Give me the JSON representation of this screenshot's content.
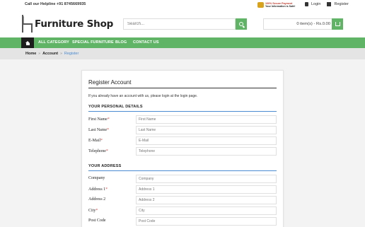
{
  "topbar": {
    "helpline": "Call our Helpline +91 8745669935",
    "secure_line1": "100% Secure Payment",
    "secure_line2": "Your Information is Safe!",
    "login": "Login",
    "register": "Register"
  },
  "header": {
    "logo": "Furniture Shop",
    "search_placeholder": "Search...",
    "cart": "0 item(s) - Rs.0.00"
  },
  "nav": {
    "items": [
      "ALL CATEGORY",
      "SPECIAL FURNITURE",
      "BLOG",
      "CONTACT US"
    ]
  },
  "breadcrumb": [
    "Home",
    "Account",
    "Register"
  ],
  "form": {
    "title": "Register Account",
    "intro": "If you already have an account with us, please login at the login page.",
    "personal_section": "YOUR PERSONAL DETAILS",
    "address_section": "YOUR ADDRESS",
    "fields": {
      "first_name": {
        "label": "First Name",
        "placeholder": "First Name"
      },
      "last_name": {
        "label": "Last Name",
        "placeholder": "Last Name"
      },
      "email": {
        "label": "E-Mail",
        "placeholder": "E-Mail"
      },
      "telephone": {
        "label": "Telephone",
        "placeholder": "Telephone"
      },
      "company": {
        "label": "Company",
        "placeholder": "Company"
      },
      "address1": {
        "label": "Address 1",
        "placeholder": "Address 1"
      },
      "address2": {
        "label": "Address 2",
        "placeholder": "Address 2"
      },
      "city": {
        "label": "City",
        "placeholder": "City"
      },
      "postcode": {
        "label": "Post Code",
        "placeholder": "Post Code"
      }
    },
    "required_mark": "*"
  },
  "colors": {
    "accent_green": "#5fb465",
    "link_blue": "#4b8bd1",
    "required_red": "#d9534f"
  }
}
